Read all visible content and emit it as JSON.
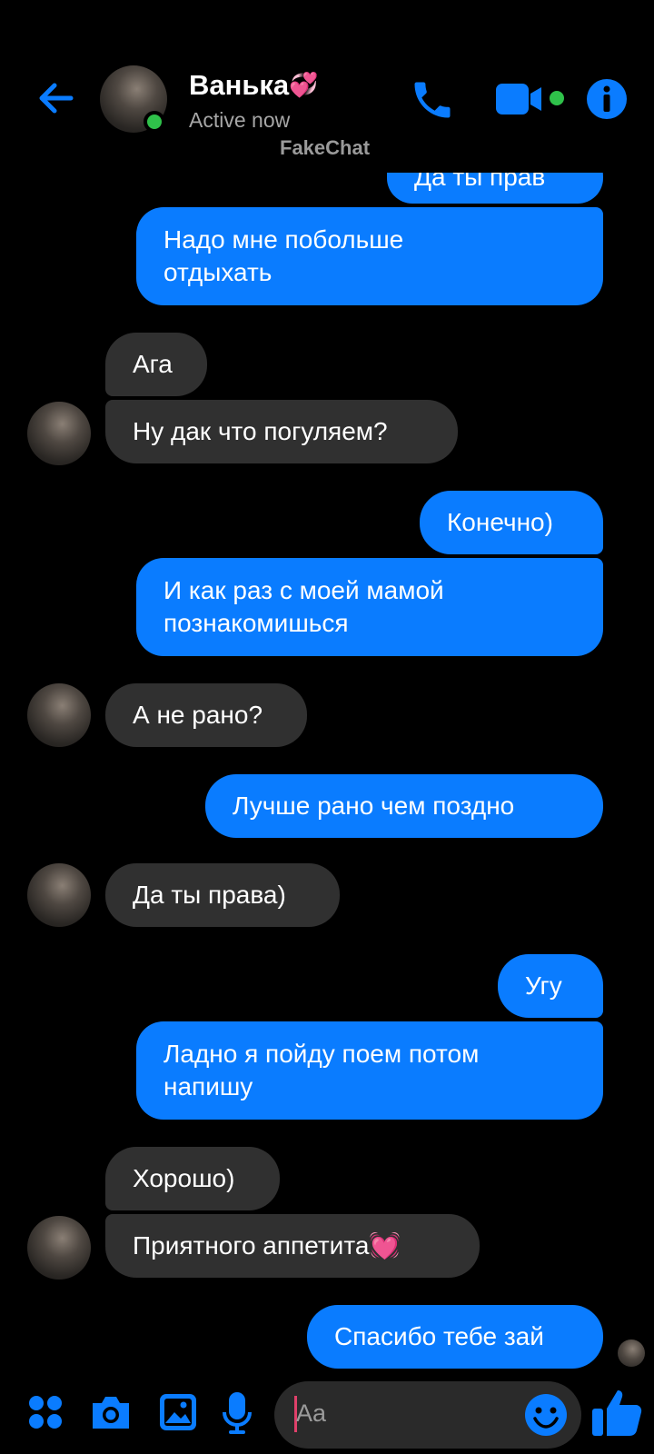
{
  "header": {
    "contact_name": "Ванька",
    "name_emoji": "💞",
    "status": "Active now",
    "watermark": "FakeChat",
    "icons": [
      "back-arrow-icon",
      "phone-icon",
      "video-camera-icon",
      "info-icon"
    ]
  },
  "colors": {
    "accent": "#0a7cff",
    "outgoing_bubble": "#0a7cff",
    "incoming_bubble": "#303030",
    "online": "#2fc14a",
    "background": "#000000"
  },
  "messages": [
    {
      "from": "me",
      "text": "Да ты прав"
    },
    {
      "from": "me",
      "text": "Надо мне побольше\nотдыхать"
    },
    {
      "from": "them",
      "text": "Ага"
    },
    {
      "from": "them",
      "text": "Ну дак что погуляем?"
    },
    {
      "from": "me",
      "text": "Конечно)"
    },
    {
      "from": "me",
      "text": "И как раз с моей мамой\nпознакомишься"
    },
    {
      "from": "them",
      "text": "А не рано?"
    },
    {
      "from": "me",
      "text": "Лучше рано чем поздно"
    },
    {
      "from": "them",
      "text": "Да ты права)"
    },
    {
      "from": "me",
      "text": "Угу"
    },
    {
      "from": "me",
      "text": "Ладно я пойду поем потом\nнапишу"
    },
    {
      "from": "them",
      "text": "Хорошо)"
    },
    {
      "from": "them",
      "text": "Приятного аппетита💓"
    },
    {
      "from": "me",
      "text": "Спасибо тебе зай"
    }
  ],
  "composer": {
    "placeholder": "Aa",
    "icons": [
      "apps-grid-icon",
      "camera-icon",
      "image-icon",
      "microphone-icon",
      "emoji-icon",
      "thumbs-up-icon"
    ]
  }
}
